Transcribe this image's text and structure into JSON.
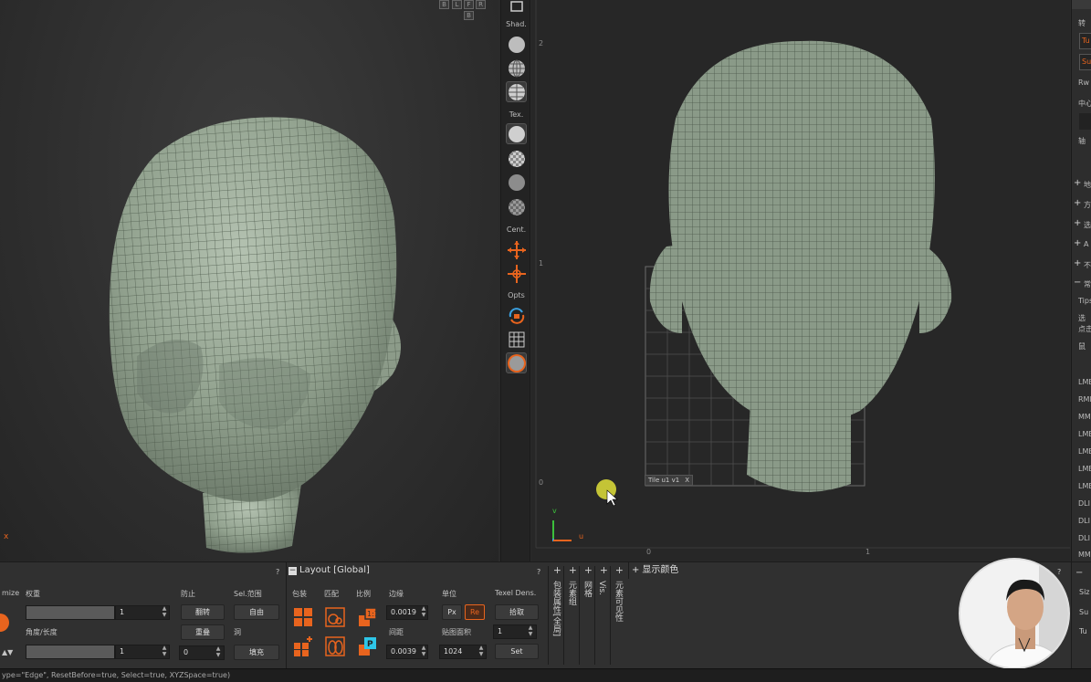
{
  "viewport3d": {
    "nav_labels": [
      "B",
      "L",
      "F",
      "R",
      "B"
    ],
    "axis_x_label": "x"
  },
  "toolstrip": {
    "shading_label": "Shad.",
    "texture_label": "Tex.",
    "center_label": "Cent.",
    "options_label": "Opts"
  },
  "uv_view": {
    "tick_2": "2",
    "tick_1": "1",
    "tick_0": "0",
    "tick_bottom_0": "0",
    "tick_bottom_1": "1",
    "axis_v": "v",
    "axis_u": "u",
    "tile_label": "Tile u1 v1",
    "tile_close": "X"
  },
  "right_panel": {
    "items": [
      "转",
      "Tu",
      "Su",
      "Rw",
      "中心",
      "轴",
      "地",
      "方",
      "选",
      "A",
      "不",
      "常",
      "Tips",
      "选",
      "点击",
      "鼠",
      "LMB",
      "RMB",
      "MMB",
      "LMB",
      "LMB",
      "LMB",
      "LMB",
      "DLI",
      "DLI",
      "DLI",
      "MM"
    ]
  },
  "bottom": {
    "optimize_label": "mize",
    "weight_label": "权重",
    "weight_value": "1",
    "angle_label": "角度/长度",
    "angle_value": "1",
    "prevent_label": "防止",
    "flip_button": "翻转",
    "overlap_button": "重叠",
    "overlap_value": "0",
    "sel_range_label": "Sel.范围",
    "free_button": "自由",
    "hole_label": "洞",
    "fill_button": "填充",
    "help_q1": "?",
    "layout_header": "Layout [Global]",
    "pack_label": "包装",
    "match_label": "匹配",
    "scale_label": "比例",
    "margin_label": "边缘",
    "margin_value": "0.0019",
    "spacing_label": "间距",
    "spacing_value": "0.0039",
    "unit_label": "单位",
    "px_button": "Px",
    "re_button": "Re",
    "map_res_label": "贴图面积",
    "map_res_value": "1024",
    "texel_label": "Texel Dens.",
    "pick_button": "拾取",
    "texel_value": "1",
    "set_button": "Set",
    "help_q2": "?",
    "vtabs": [
      "包装属性[全局]",
      "元素组",
      "网格",
      "Vis.",
      "元素可见性"
    ],
    "display_color_header": "显示颜色",
    "help_q3": "?",
    "right_items": [
      "Siz",
      "Su",
      "Tu"
    ]
  },
  "statusbar": {
    "text": "ype=\"Edge\", ResetBefore=true, Select=true, XYZSpace=true)"
  },
  "colors": {
    "accent_orange": "#e8641e",
    "mesh_fill": "#8a9a88",
    "cursor_yellow": "#e1e03a"
  }
}
